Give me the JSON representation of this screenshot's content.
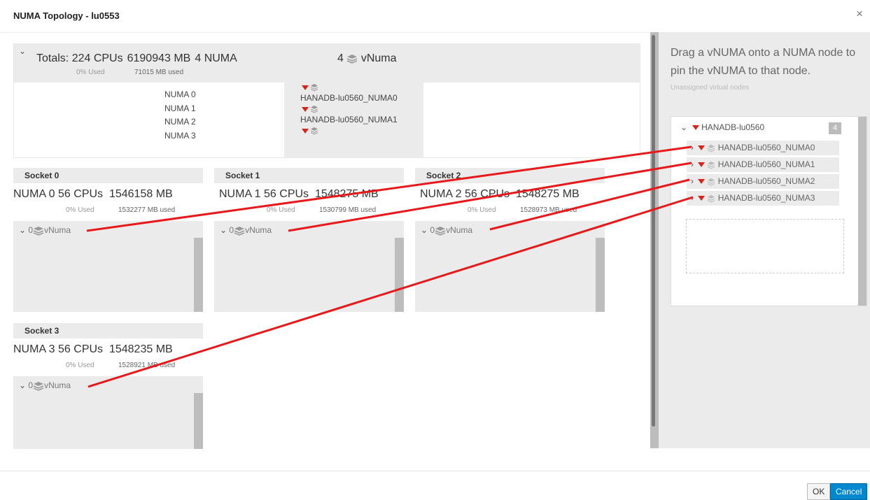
{
  "dialog": {
    "title": "NUMA Topology - lu0553",
    "close_label": "×"
  },
  "totals": {
    "cpus": "Totals: 224 CPUs",
    "memory": "6190943 MB",
    "numa": "4 NUMA",
    "cpu_used": "0% Used",
    "mem_used": "71015 MB used",
    "vnuma_count": "4",
    "vnuma_label": "vNuma",
    "numa_nodes": [
      "NUMA 0",
      "NUMA 1",
      "NUMA 2",
      "NUMA 3"
    ],
    "vnuma_nodes": [
      "HANADB-lu0560_NUMA0",
      "HANADB-lu0560_NUMA1"
    ]
  },
  "sockets": [
    {
      "title": "Socket 0",
      "numa": "NUMA 0",
      "cpus": "56 CPUs",
      "memory": "1546158 MB",
      "cpu_used": "0% Used",
      "mem_used": "1532277 MB used",
      "vnuma_count": "0",
      "vnuma_label": "vNuma"
    },
    {
      "title": "Socket 1",
      "numa": "NUMA 1",
      "cpus": "56 CPUs",
      "memory": "1548275 MB",
      "cpu_used": "0% Used",
      "mem_used": "1530799 MB used",
      "vnuma_count": "0",
      "vnuma_label": "vNuma"
    },
    {
      "title": "Socket 2",
      "numa": "NUMA 2",
      "cpus": "56 CPUs",
      "memory": "1548275 MB",
      "cpu_used": "0% Used",
      "mem_used": "1528973 MB used",
      "vnuma_count": "0",
      "vnuma_label": "vNuma"
    },
    {
      "title": "Socket 3",
      "numa": "NUMA 3",
      "cpus": "56 CPUs",
      "memory": "1548235 MB",
      "cpu_used": "0% Used",
      "mem_used": "1528921 MB used",
      "vnuma_count": "0",
      "vnuma_label": "vNuma"
    }
  ],
  "unassigned": {
    "instruction": "Drag a vNUMA onto a NUMA node to pin the vNUMA to that node.",
    "subtitle": "Unassigned virtual nodes",
    "vm_name": "HANADB-lu0560",
    "count": "4",
    "items": [
      "HANADB-lu0560_NUMA0",
      "HANADB-lu0560_NUMA1",
      "HANADB-lu0560_NUMA2",
      "HANADB-lu0560_NUMA3"
    ]
  },
  "footer": {
    "ok_label": "OK",
    "cancel_label": "Cancel"
  },
  "colors": {
    "accent": "#0088ce",
    "vnuma_marker": "#d9241b",
    "annotation": "#e8191b",
    "panel_bg": "#ebebeb"
  }
}
